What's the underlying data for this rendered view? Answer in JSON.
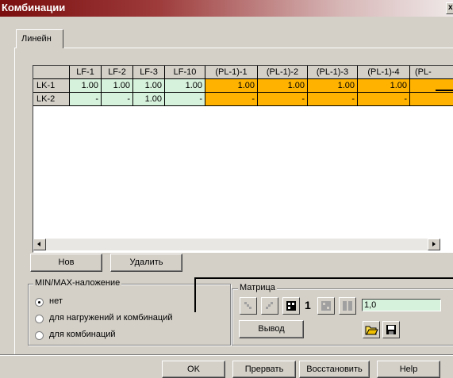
{
  "window": {
    "title": "Комбинации",
    "close_glyph": "x"
  },
  "tab": {
    "label": "Линейн"
  },
  "grid": {
    "columns": [
      "LF-1",
      "LF-2",
      "LF-3",
      "LF-10",
      "(PL-1)-1",
      "(PL-1)-2",
      "(PL-1)-3",
      "(PL-1)-4",
      "(PL-"
    ],
    "rows": [
      {
        "name": "LK-1",
        "cells": [
          "1.00",
          "1.00",
          "1.00",
          "1.00",
          "1.00",
          "1.00",
          "1.00",
          "1.00",
          ""
        ]
      },
      {
        "name": "LK-2",
        "cells": [
          "-",
          "-",
          "1.00",
          "-",
          "-",
          "-",
          "-",
          "-",
          ""
        ]
      }
    ],
    "colors": {
      "load": "#d7f2dc",
      "combination": "#ffb300"
    }
  },
  "buttons": {
    "new": "Нов",
    "delete": "Удалить",
    "output": "Вывод",
    "ok": "OK",
    "cancel": "Прервать",
    "restore": "Восстановить",
    "help": "Help"
  },
  "minmax": {
    "title": "MIN/MAX-наложение",
    "options": [
      {
        "label": "нет",
        "selected": true
      },
      {
        "label": "для нагружений и комбинаций",
        "selected": false
      },
      {
        "label": "для комбинаций",
        "selected": false
      }
    ]
  },
  "matrix": {
    "title": "Матрица",
    "counter": "1",
    "value": "1,0"
  },
  "icons": [
    "scroll-left-icon",
    "scroll-right-icon",
    "matrix-lower-icon",
    "matrix-upper-icon",
    "matrix-full-icon",
    "matrix-grid-icon",
    "matrix-columns-icon",
    "open-folder-icon",
    "save-disk-icon"
  ]
}
